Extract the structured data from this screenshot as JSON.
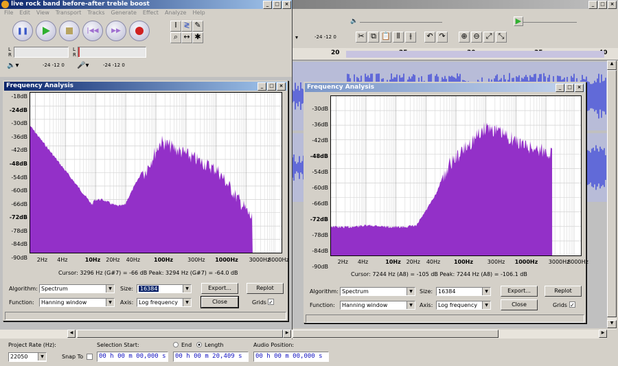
{
  "window": {
    "title": "live rock band before-after treble boost"
  },
  "menu": [
    "File",
    "Edit",
    "View",
    "Transport",
    "Tracks",
    "Generate",
    "Effect",
    "Analyze",
    "Help"
  ],
  "meter": {
    "l": "L",
    "r": "R",
    "ticks_a": "-24  -12  0",
    "ticks_b": "-24  -12  0",
    "ticks_c": "-24  -12  0"
  },
  "ruler": {
    "labels": [
      "20",
      "25",
      "30",
      "35",
      "40"
    ]
  },
  "left_dialog": {
    "title": "Frequency Analysis",
    "y_labels": [
      "-18dB",
      "-24dB",
      "-30dB",
      "-36dB",
      "-42dB",
      "-48dB",
      "-54dB",
      "-60dB",
      "-66dB",
      "-72dB",
      "-78dB",
      "-84dB",
      "-90dB"
    ],
    "x_labels": [
      "2Hz",
      "4Hz",
      "10Hz",
      "20Hz",
      "40Hz",
      "100Hz",
      "300Hz",
      "1000Hz",
      "3000Hz",
      "8000Hz"
    ],
    "cursor_text": "Cursor: 3296 Hz (G#7) = -66 dB    Peak: 3294 Hz (G#7) = -64.0 dB",
    "algorithm_label": "Algorithm:",
    "algorithm": "Spectrum",
    "size_label": "Size:",
    "size": "16384",
    "function_label": "Function:",
    "function": "Hanning window",
    "axis_label": "Axis:",
    "axis": "Log frequency",
    "export": "Export...",
    "replot": "Replot",
    "close": "Close",
    "grids": "Grids"
  },
  "right_dialog": {
    "title": "Frequency Analysis",
    "y_labels": [
      "-30dB",
      "-36dB",
      "-42dB",
      "-48dB",
      "-54dB",
      "-60dB",
      "-66dB",
      "-72dB",
      "-78dB",
      "-84dB",
      "-90dB"
    ],
    "x_labels": [
      "2Hz",
      "4Hz",
      "10Hz",
      "20Hz",
      "40Hz",
      "100Hz",
      "300Hz",
      "1000Hz",
      "3000Hz",
      "8000Hz"
    ],
    "cursor_text": "Cursor: 7244 Hz (A8) = -105 dB    Peak: 7244 Hz (A8) = -106.1 dB",
    "algorithm_label": "Algorithm:",
    "algorithm": "Spectrum",
    "size_label": "Size:",
    "size": "16384",
    "function_label": "Function:",
    "function": "Hanning window",
    "axis_label": "Axis:",
    "axis": "Log frequency",
    "export": "Export...",
    "replot": "Replot",
    "close": "Close",
    "grids": "Grids"
  },
  "statusbar": {
    "project_rate_label": "Project Rate (Hz):",
    "project_rate": "22050",
    "snap_to": "Snap To",
    "selection_start_label": "Selection Start:",
    "end_label": "End",
    "length_label": "Length",
    "audio_position_label": "Audio Position:",
    "sel_start": "00 h 00 m 00,000 s",
    "sel_length": "00 h 00 m 20,409 s",
    "audio_pos": "00 h 00 m 00,000 s"
  },
  "colors": {
    "spectrum": "#9330c8",
    "title_active": "#0a246a",
    "waveform": "#3c46d8"
  }
}
